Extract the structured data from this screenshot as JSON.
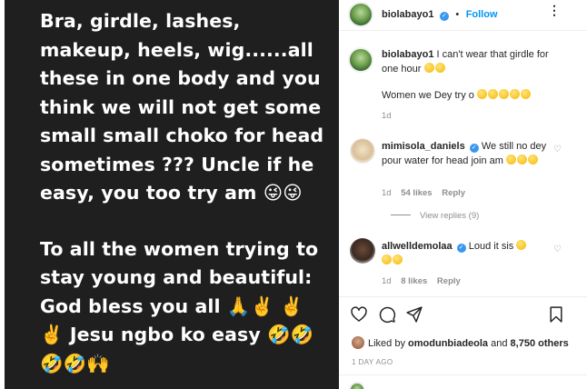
{
  "story": {
    "paragraph1": "Bra, girdle, lashes, makeup, heels, wig......all these in one body and you think we will not get some small small choko for head sometimes ??? Uncle if he easy, you too try am",
    "paragraph1_emojis": "😜😜",
    "paragraph2": "To all the women trying to stay young and beautiful: God bless you all",
    "paragraph2_emojis_mid": "🙏✌️ ✌️ ✌️",
    "paragraph2_tail": "Jesu ngbo ko easy",
    "paragraph2_emojis_end": "🤣🤣🤣🤣🙌"
  },
  "header": {
    "username": "biolabayo1",
    "verified_mark": "✓",
    "dot": "•",
    "follow_label": "Follow",
    "more_label": "⋮"
  },
  "caption": {
    "username": "biolabayo1",
    "text": "I can't wear that girdle for one hour",
    "line2": "Women we Dey try o",
    "time": "1d"
  },
  "comments": [
    {
      "username": "mimisola_daniels",
      "verified_mark": "✓",
      "text": "We still no dey pour water for head join am",
      "time": "1d",
      "likes": "54 likes",
      "reply": "Reply"
    },
    {
      "username": "allwelldemolaa",
      "verified_mark": "✓",
      "text": "Loud it sis",
      "time": "1d",
      "likes": "8 likes",
      "reply": "Reply"
    }
  ],
  "view_replies": "View replies (9)",
  "liked_by": {
    "prefix": "Liked by",
    "user": "omodunbiadeola",
    "and": "and",
    "others": "8,750 others"
  },
  "timestamp": "1 DAY AGO",
  "icons": [
    "heart-icon",
    "comment-icon",
    "share-icon",
    "bookmark-icon"
  ],
  "colors": {
    "accent": "#0095f6",
    "verified": "#3897f0",
    "story_bg": "#201f1f"
  }
}
